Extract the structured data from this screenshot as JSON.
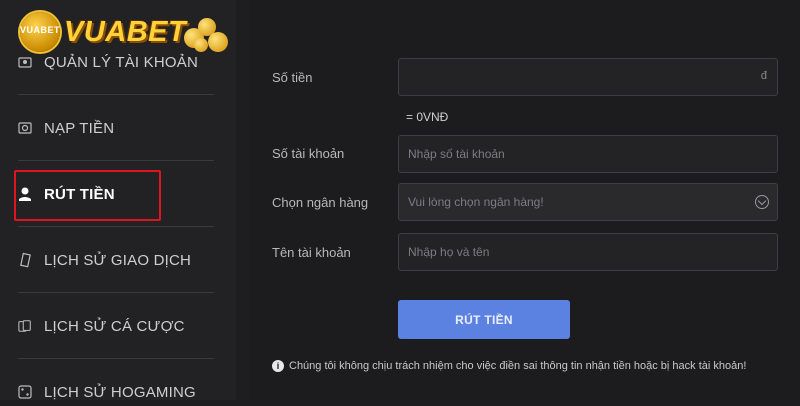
{
  "logo": {
    "brand": "VUABET",
    "badge": "VUABET",
    "tagline": "ONLINE"
  },
  "sidebar": {
    "items": [
      {
        "label": "QUẢN LÝ TÀI KHOẢN",
        "icon": "account-icon"
      },
      {
        "label": "NẠP TIỀN",
        "icon": "deposit-icon"
      },
      {
        "label": "RÚT TIỀN",
        "icon": "withdraw-icon",
        "active": true
      },
      {
        "label": "LỊCH SỬ GIAO DỊCH",
        "icon": "transaction-history-icon"
      },
      {
        "label": "LỊCH SỬ CÁ CƯỢC",
        "icon": "bet-history-icon"
      },
      {
        "label": "LỊCH SỬ HOGAMING",
        "icon": "hogaming-history-icon"
      }
    ],
    "highlight_color": "#e0141e"
  },
  "form": {
    "amount": {
      "label": "Số tiền",
      "value": "",
      "suffix": "đ"
    },
    "converted": "= 0VNĐ",
    "account_number": {
      "label": "Số tài khoản",
      "placeholder": "Nhập số tài khoản"
    },
    "bank": {
      "label": "Chọn ngân hàng",
      "placeholder": "Vui lòng chọn ngân hàng!"
    },
    "account_name": {
      "label": "Tên tài khoản",
      "placeholder": "Nhập họ và tên"
    },
    "submit_label": "RÚT TIỀN",
    "submit_color": "#5b82e0",
    "notice": "Chúng tôi không chịu trách nhiệm cho việc điền sai thông tin nhận tiền hoặc bị hack tài khoản!"
  }
}
